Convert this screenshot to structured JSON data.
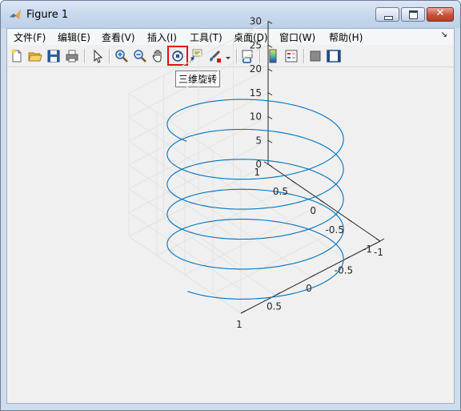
{
  "window": {
    "title": "Figure 1"
  },
  "menu": [
    {
      "label": "文件(F)"
    },
    {
      "label": "编辑(E)"
    },
    {
      "label": "查看(V)"
    },
    {
      "label": "插入(I)"
    },
    {
      "label": "工具(T)"
    },
    {
      "label": "桌面(D)"
    },
    {
      "label": "窗口(W)"
    },
    {
      "label": "帮助(H)"
    }
  ],
  "toolbar": {
    "icons": [
      "new-figure-icon",
      "open-file-icon",
      "save-icon",
      "print-icon",
      "select-arrow-icon",
      "zoom-in-icon",
      "zoom-out-icon",
      "pan-hand-icon",
      "rotate-3d-icon",
      "data-cursor-icon",
      "brush-icon",
      "link-plot-icon",
      "colorbar-icon",
      "legend-icon",
      "hide-plot-tools-icon",
      "show-plot-tools-icon"
    ],
    "tooltip": "三维旋转"
  },
  "chart_data": {
    "type": "line",
    "projection": "3d",
    "title": "",
    "xlabel": "",
    "ylabel": "",
    "zlabel": "",
    "xlim": [
      -1,
      1
    ],
    "ylim": [
      -1,
      1
    ],
    "zlim": [
      0,
      30
    ],
    "x_ticks": [
      "-1",
      "-0.5",
      "0",
      "0.5",
      "1"
    ],
    "y_ticks": [
      "-1",
      "-0.5",
      "0",
      "0.5",
      "1"
    ],
    "z_ticks": [
      "0",
      "5",
      "10",
      "15",
      "20",
      "25",
      "30"
    ],
    "grid": true,
    "series": [
      {
        "function": "x = sin(t), y = cos(t), z = t",
        "t_range": [
          0,
          31.4
        ],
        "color": "#0072bd"
      }
    ]
  }
}
